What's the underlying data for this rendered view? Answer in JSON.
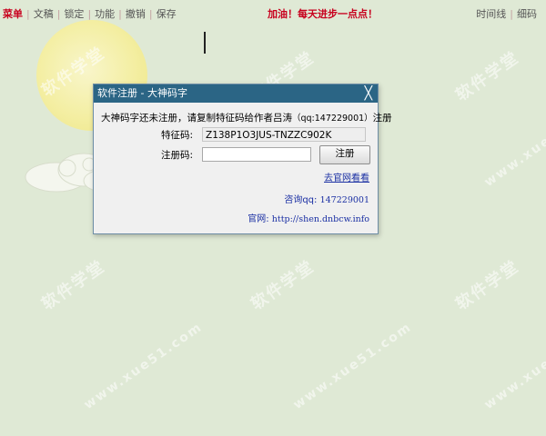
{
  "toolbar": {
    "menu": "菜单",
    "items": [
      "文稿",
      "锁定",
      "功能",
      "撤销",
      "保存"
    ],
    "slogan": "加油！每天进步一点点！",
    "right_items": [
      "时间线",
      "细码"
    ]
  },
  "background": {
    "watermark": "软件学堂",
    "watermark_url": "www.xue51.com"
  },
  "dialog": {
    "title": "软件注册 - 大神码字",
    "close": "╳",
    "notice_text": "大神码字还未注册，请复制特征码给作者吕涛",
    "notice_qq": "（qq:147229001）",
    "notice_end": "注册",
    "feature_label": "特征码:",
    "feature_value": "Z138P1O3JUS-TNZZC902K",
    "reg_label": "注册码:",
    "reg_value": "",
    "register_button": "注册",
    "website_link": "去官网看看",
    "contact_label": "咨询qq:",
    "contact_value": "147229001",
    "site_label": "官网:",
    "site_value": "http://shen.dnbcw.info"
  },
  "colors": {
    "background": "#dfe9d5",
    "accent_red": "#c8001e",
    "titlebar": "#2b6585",
    "link_blue": "#1a2fa3"
  }
}
